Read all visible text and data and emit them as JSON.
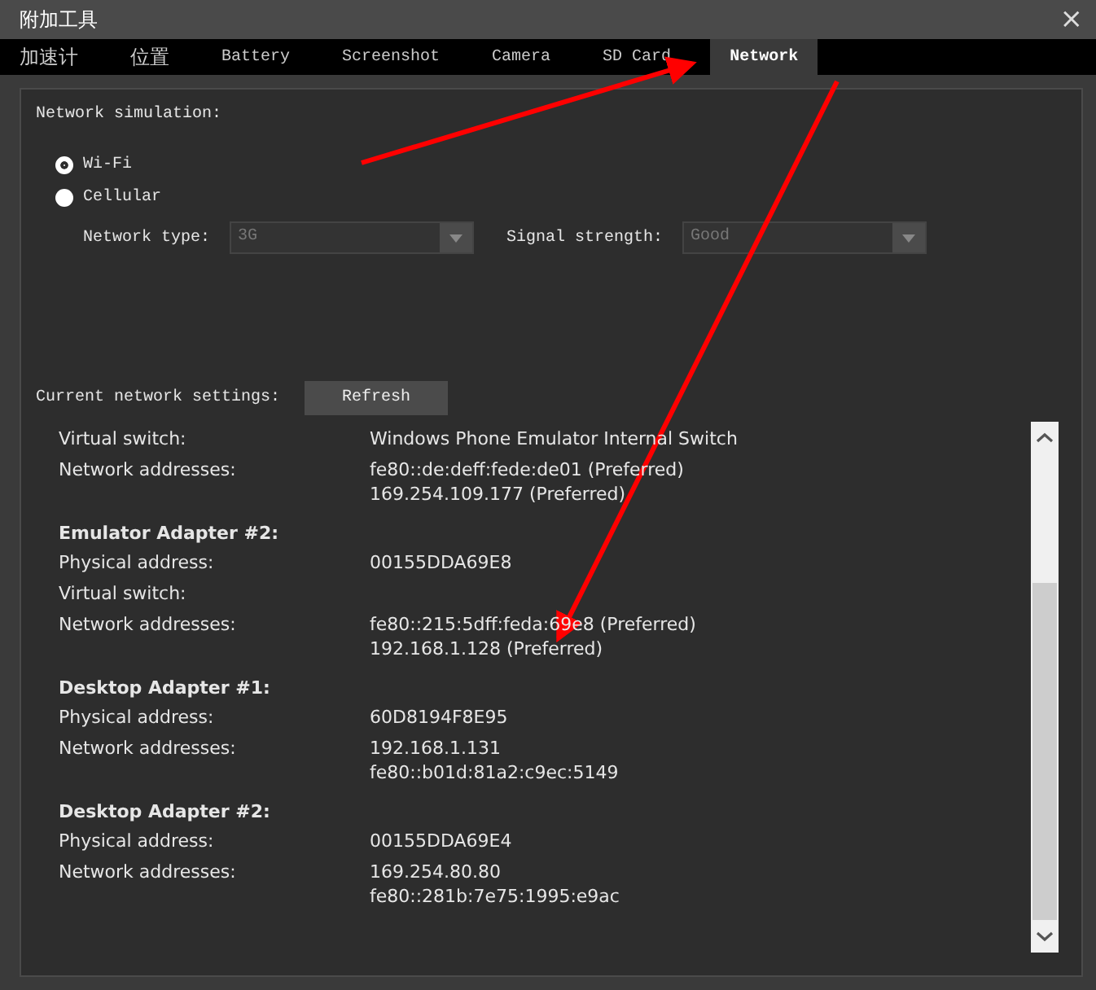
{
  "window": {
    "title": "附加工具",
    "close": "×"
  },
  "tabs": [
    {
      "label": "加速计",
      "selected": false
    },
    {
      "label": "位置",
      "selected": false
    },
    {
      "label": "Battery",
      "selected": false
    },
    {
      "label": "Screenshot",
      "selected": false
    },
    {
      "label": "Camera",
      "selected": false
    },
    {
      "label": "SD Card",
      "selected": false
    },
    {
      "label": "Network",
      "selected": true
    }
  ],
  "simulation": {
    "heading": "Network simulation:",
    "options": [
      {
        "label": "Wi-Fi",
        "selected": true
      },
      {
        "label": "Cellular",
        "selected": false
      }
    ],
    "network_type": {
      "label": "Network type:",
      "value": "3G",
      "disabled": true
    },
    "signal_strength": {
      "label": "Signal strength:",
      "value": "Good",
      "disabled": true
    }
  },
  "current": {
    "label": "Current network settings:",
    "refresh": "Refresh"
  },
  "adapters": [
    {
      "rows": [
        {
          "label": "Virtual switch:",
          "values": [
            "Windows Phone Emulator Internal Switch"
          ]
        },
        {
          "label": "Network addresses:",
          "values": [
            "fe80::de:deff:fede:de01 (Preferred)",
            "169.254.109.177 (Preferred)"
          ]
        }
      ]
    },
    {
      "name": "Emulator Adapter #2:",
      "rows": [
        {
          "label": "Physical address:",
          "values": [
            "00155DDA69E8"
          ]
        },
        {
          "label": "Virtual switch:",
          "values": []
        },
        {
          "label": "Network addresses:",
          "values": [
            "fe80::215:5dff:feda:69e8 (Preferred)",
            "192.168.1.128 (Preferred)"
          ]
        }
      ]
    },
    {
      "name": "Desktop Adapter #1:",
      "rows": [
        {
          "label": "Physical address:",
          "values": [
            "60D8194F8E95"
          ]
        },
        {
          "label": "Network addresses:",
          "values": [
            "192.168.1.131",
            "fe80::b01d:81a2:c9ec:5149"
          ]
        }
      ]
    },
    {
      "name": "Desktop Adapter #2:",
      "rows": [
        {
          "label": "Physical address:",
          "values": [
            "00155DDA69E4"
          ]
        },
        {
          "label": "Network addresses:",
          "values": [
            "169.254.80.80",
            "fe80::281b:7e75:1995:e9ac"
          ]
        }
      ]
    }
  ]
}
